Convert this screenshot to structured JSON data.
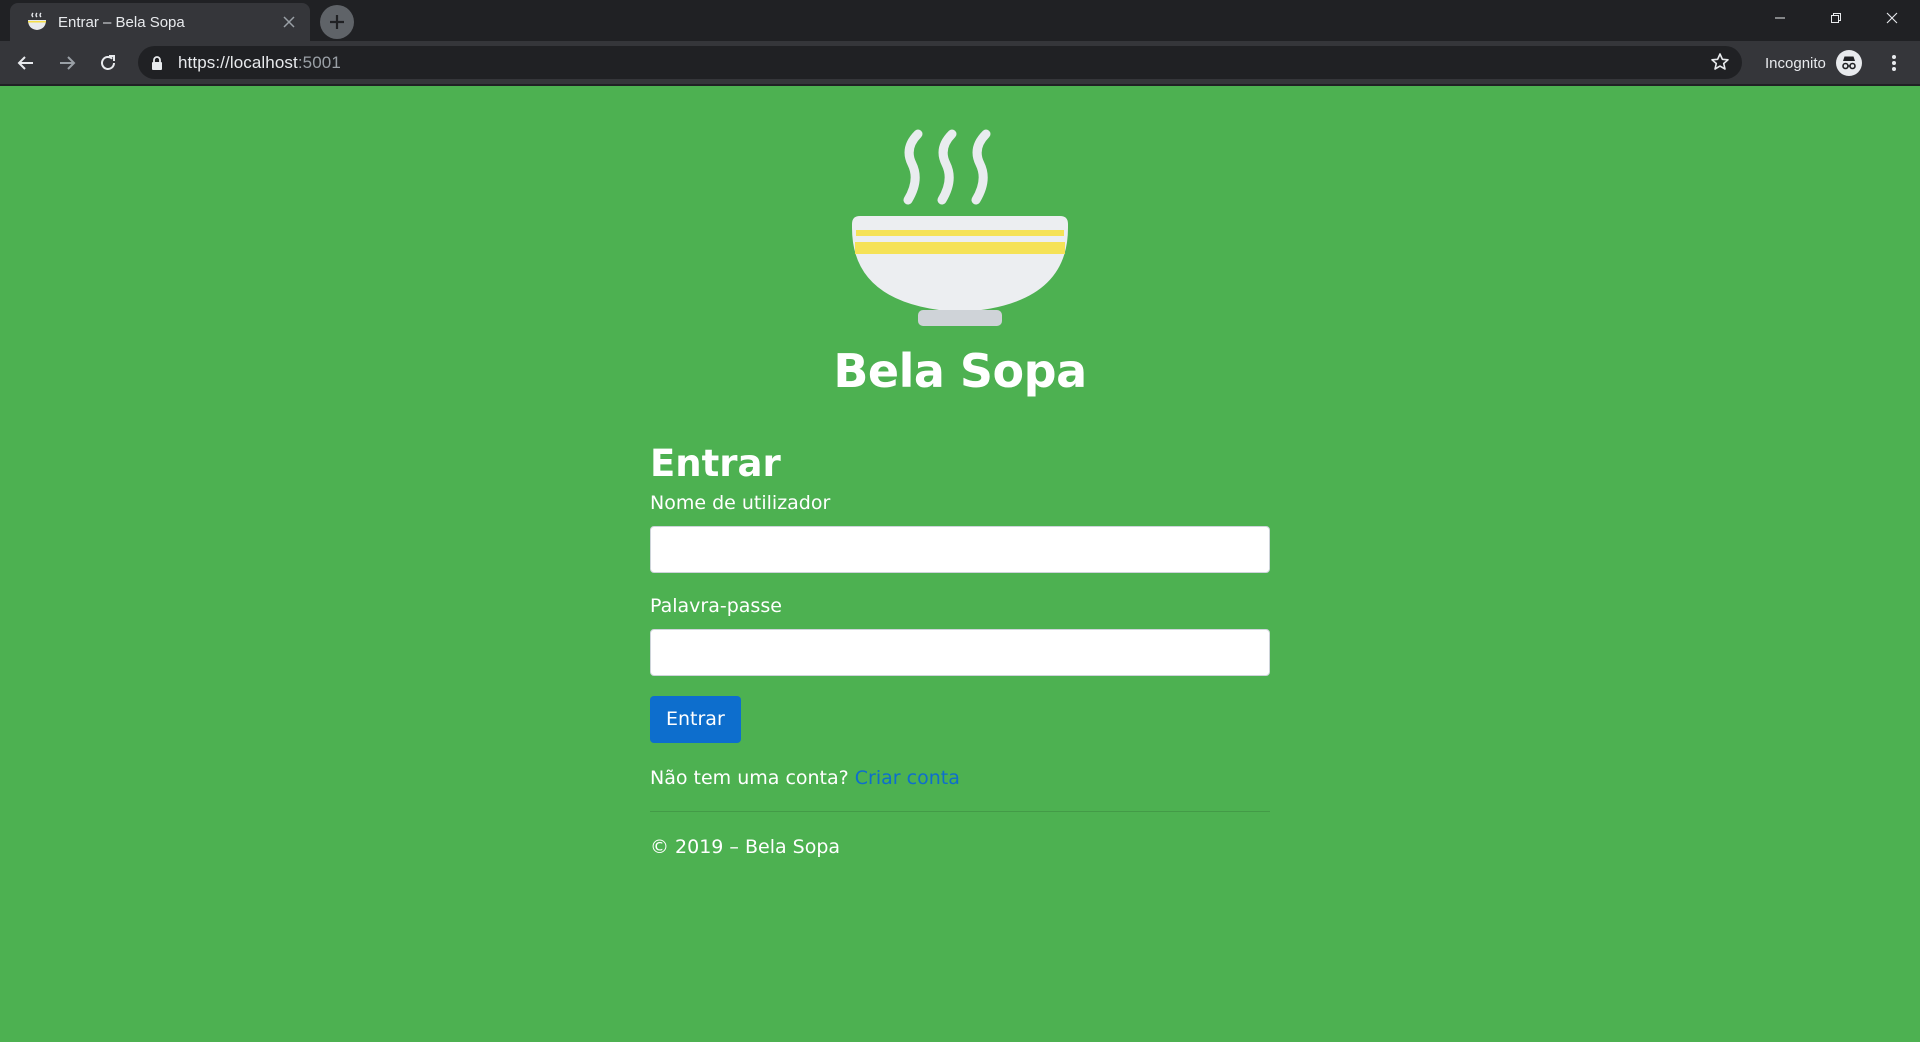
{
  "browser": {
    "tab_title": "Entrar – Bela Sopa",
    "tab_favicon": "soup-bowl-icon",
    "url_host": "https://localhost",
    "url_port": ":5001",
    "profile_label": "Incognito"
  },
  "app": {
    "brand_name": "Bela Sopa",
    "logo": "soup-bowl-steam-icon"
  },
  "login": {
    "heading": "Entrar",
    "username_label": "Nome de utilizador",
    "username_value": "",
    "password_label": "Palavra-passe",
    "password_value": "",
    "submit_label": "Entrar",
    "signup_prompt": "Não tem uma conta?",
    "signup_link": "Criar conta"
  },
  "footer": {
    "text": "© 2019 – Bela Sopa"
  },
  "colors": {
    "page_background": "#4db151",
    "primary_button": "#0d6ecd",
    "link": "#0d6ecd",
    "browser_frame": "#202124",
    "browser_toolbar": "#35363a"
  }
}
